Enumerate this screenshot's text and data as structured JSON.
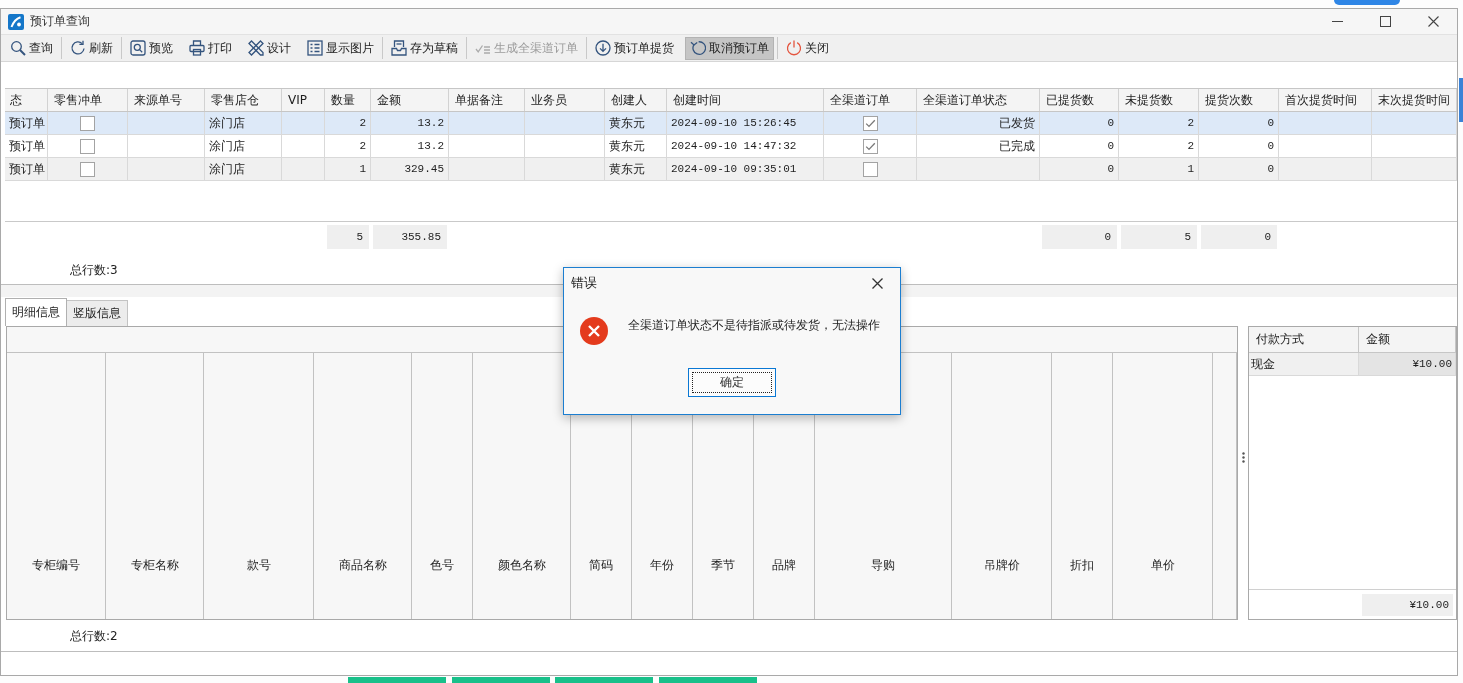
{
  "window": {
    "title": "预订单查询"
  },
  "toolbar": [
    {
      "buttons": [
        {
          "label": "查询",
          "disabled": false,
          "highlighted": false
        }
      ]
    },
    {
      "buttons": [
        {
          "label": "刷新",
          "disabled": false,
          "highlighted": false
        }
      ]
    },
    {
      "buttons": [
        {
          "label": "预览",
          "disabled": false,
          "highlighted": false
        },
        {
          "label": "打印",
          "disabled": false,
          "highlighted": false
        },
        {
          "label": "设计",
          "disabled": false,
          "highlighted": false
        },
        {
          "label": "显示图片",
          "disabled": false,
          "highlighted": false
        }
      ]
    },
    {
      "buttons": [
        {
          "label": "存为草稿",
          "disabled": false,
          "highlighted": false
        }
      ]
    },
    {
      "buttons": [
        {
          "label": "生成全渠道订单",
          "disabled": true,
          "highlighted": false
        }
      ]
    },
    {
      "buttons": [
        {
          "label": "预订单提货",
          "disabled": false,
          "highlighted": false
        },
        {
          "label": "取消预订单",
          "disabled": false,
          "highlighted": true
        }
      ]
    },
    {
      "buttons": [
        {
          "label": "关闭",
          "disabled": false,
          "highlighted": false
        }
      ]
    }
  ],
  "orders_table": {
    "columns": [
      {
        "label": "态",
        "kind": "text",
        "cells": [
          "预订单",
          "预订单",
          "预订单"
        ]
      },
      {
        "label": "零售冲单",
        "kind": "check",
        "cells": [
          {
            "checked": false
          },
          {
            "checked": false
          },
          {
            "checked": false
          }
        ]
      },
      {
        "label": "来源单号"
      },
      {
        "label": "零售店仓",
        "kind": "text",
        "cells": [
          "涂门店",
          "涂门店",
          "涂门店"
        ]
      },
      {
        "label": "VIP"
      },
      {
        "label": "数量",
        "kind": "number",
        "cells": [
          "2",
          "2",
          "1"
        ],
        "total": "5"
      },
      {
        "label": "金额",
        "kind": "number",
        "cells": [
          "13.2",
          "13.2",
          "329.45"
        ],
        "total": "355.85"
      },
      {
        "label": "单据备注"
      },
      {
        "label": "业务员"
      },
      {
        "label": "创建人",
        "kind": "text",
        "cells": [
          "黄东元",
          "黄东元",
          "黄东元"
        ]
      },
      {
        "label": "创建时间",
        "kind": "date",
        "cells": [
          "2024-09-10 15:26:45",
          "2024-09-10 14:47:32",
          "2024-09-10 09:35:01"
        ]
      },
      {
        "label": "全渠道订单",
        "kind": "check",
        "cells": [
          {
            "checked": true
          },
          {
            "checked": true
          },
          {
            "checked": false
          }
        ]
      },
      {
        "label": "全渠道订单状态",
        "kind": "status",
        "cells": [
          "已发货",
          "已完成"
        ]
      },
      {
        "label": "已提货数",
        "kind": "number",
        "cells": [
          "0",
          "0",
          "0"
        ],
        "total": "0"
      },
      {
        "label": "未提货数",
        "kind": "number",
        "cells": [
          "2",
          "2",
          "1"
        ],
        "total": "5"
      },
      {
        "label": "提货次数",
        "kind": "number",
        "cells": [
          "0",
          "0",
          "0"
        ],
        "total": "0"
      },
      {
        "label": "首次提货时间"
      },
      {
        "label": "末次提货时间"
      }
    ],
    "rows": [
      {
        "selected": true
      },
      {
        "selected": false
      },
      {
        "selected": false
      }
    ],
    "row_count": "总行数:3"
  },
  "detail_tabs": [
    {
      "label": "明细信息",
      "selected": true
    },
    {
      "label": "竖版信息",
      "selected": false
    }
  ],
  "detail_table": {
    "columns": [
      "专柜编号",
      "专柜名称",
      "款号",
      "商品名称",
      "色号",
      "颜色名称",
      "简码",
      "年份",
      "季节",
      "品牌",
      "导购",
      "吊牌价",
      "折扣",
      "单价"
    ],
    "row_count": "总行数:2"
  },
  "payments": {
    "columns": [
      {
        "label": "付款方式",
        "kind": "text"
      },
      {
        "label": "金额",
        "kind": "number"
      }
    ],
    "rows": [
      [
        "现金",
        "¥10.00"
      ]
    ],
    "total": "¥10.00"
  },
  "dialog": {
    "title": "错误",
    "message": "全渠道订单状态不是待指派或待发货，无法操作",
    "button": "确定"
  }
}
